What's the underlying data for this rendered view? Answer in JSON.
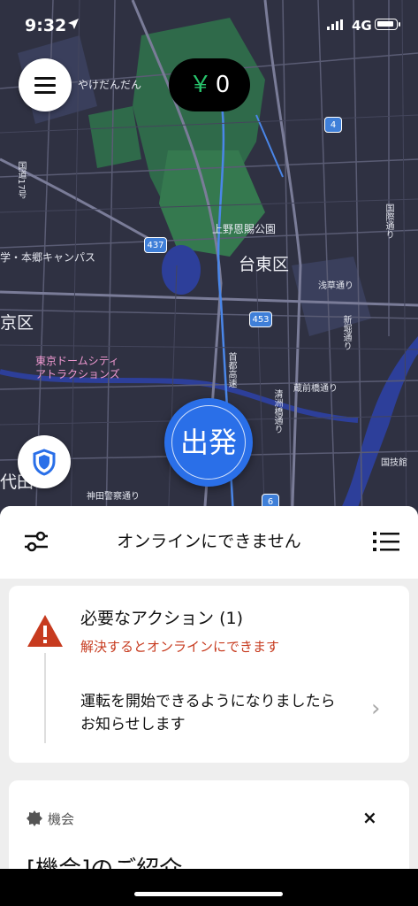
{
  "status_bar": {
    "time": "9:32",
    "network": "4G"
  },
  "map": {
    "labels": {
      "yanesen": "やけだんだん",
      "ueno_park": "上野恩賜公園",
      "taito": "台東区",
      "hongo": "学・本郷キャンパス",
      "bunkyo": "京区",
      "tokyo_dome": "東京ドームシティ",
      "tokyo_dome_2": "アトラクションズ",
      "kokugikan": "国技館",
      "chiyoda": "代田",
      "kanda": "神田警察通り",
      "asakusa": "浅草通り",
      "kokusai": "国際通り",
      "kuramae": "蔵前橋通り",
      "shinhori": "新堀通り",
      "kiyosu": "清洲橋通り",
      "shuto": "首都高速",
      "kokudo17": "国道17号"
    },
    "route_numbers": {
      "r437": "437",
      "r453": "453",
      "r4": "4",
      "r6": "6"
    }
  },
  "earnings": {
    "currency": "￥",
    "amount": "0"
  },
  "go_button": {
    "label": "出発"
  },
  "sheet": {
    "status_text": "オンラインにできません",
    "action_card": {
      "title": "必要なアクション (1)",
      "subtitle": "解決するとオンラインにできます",
      "description": "運転を開始できるようになりましたらお知らせします",
      "chevron": "›"
    },
    "opportunity_card": {
      "tag": "機会",
      "close": "×",
      "heading": "[機会]のご紹介"
    }
  },
  "colors": {
    "accent_blue": "#2a6fe8",
    "earnings_green": "#27c36b",
    "warning_red": "#c73b1f"
  }
}
